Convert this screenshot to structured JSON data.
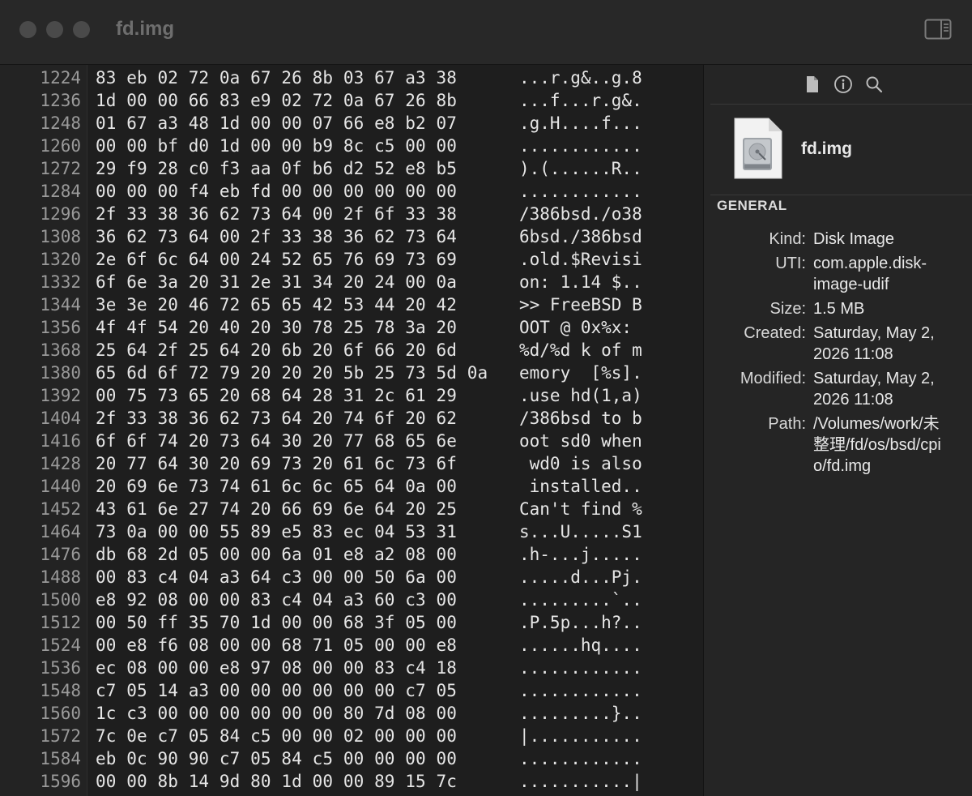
{
  "window": {
    "title": "fd.img"
  },
  "hex": {
    "rows": [
      {
        "offset": "1224",
        "bytes": "83 eb 02 72 0a 67 26 8b 03 67 a3 38",
        "ascii": "...r.g&..g.8"
      },
      {
        "offset": "1236",
        "bytes": "1d 00 00 66 83 e9 02 72 0a 67 26 8b",
        "ascii": "...f...r.g&."
      },
      {
        "offset": "1248",
        "bytes": "01 67 a3 48 1d 00 00 07 66 e8 b2 07",
        "ascii": ".g.H....f..."
      },
      {
        "offset": "1260",
        "bytes": "00 00 bf d0 1d 00 00 b9 8c c5 00 00",
        "ascii": "............"
      },
      {
        "offset": "1272",
        "bytes": "29 f9 28 c0 f3 aa 0f b6 d2 52 e8 b5",
        "ascii": ").(......R.."
      },
      {
        "offset": "1284",
        "bytes": "00 00 00 f4 eb fd 00 00 00 00 00 00",
        "ascii": "............"
      },
      {
        "offset": "1296",
        "bytes": "2f 33 38 36 62 73 64 00 2f 6f 33 38",
        "ascii": "/386bsd./o38"
      },
      {
        "offset": "1308",
        "bytes": "36 62 73 64 00 2f 33 38 36 62 73 64",
        "ascii": "6bsd./386bsd"
      },
      {
        "offset": "1320",
        "bytes": "2e 6f 6c 64 00 24 52 65 76 69 73 69",
        "ascii": ".old.$Revisi"
      },
      {
        "offset": "1332",
        "bytes": "6f 6e 3a 20 31 2e 31 34 20 24 00 0a",
        "ascii": "on: 1.14 $.."
      },
      {
        "offset": "1344",
        "bytes": "3e 3e 20 46 72 65 65 42 53 44 20 42",
        "ascii": ">> FreeBSD B"
      },
      {
        "offset": "1356",
        "bytes": "4f 4f 54 20 40 20 30 78 25 78 3a 20",
        "ascii": "OOT @ 0x%x: "
      },
      {
        "offset": "1368",
        "bytes": "25 64 2f 25 64 20 6b 20 6f 66 20 6d",
        "ascii": "%d/%d k of m"
      },
      {
        "offset": "1380",
        "bytes": "65 6d 6f 72 79 20 20 20 5b 25 73 5d 0a",
        "ascii": "emory  [%s]."
      },
      {
        "offset": "1392",
        "bytes": "00 75 73 65 20 68 64 28 31 2c 61 29",
        "ascii": ".use hd(1,a)"
      },
      {
        "offset": "1404",
        "bytes": "2f 33 38 36 62 73 64 20 74 6f 20 62",
        "ascii": "/386bsd to b"
      },
      {
        "offset": "1416",
        "bytes": "6f 6f 74 20 73 64 30 20 77 68 65 6e",
        "ascii": "oot sd0 when"
      },
      {
        "offset": "1428",
        "bytes": "20 77 64 30 20 69 73 20 61 6c 73 6f",
        "ascii": " wd0 is also"
      },
      {
        "offset": "1440",
        "bytes": "20 69 6e 73 74 61 6c 6c 65 64 0a 00",
        "ascii": " installed.."
      },
      {
        "offset": "1452",
        "bytes": "43 61 6e 27 74 20 66 69 6e 64 20 25",
        "ascii": "Can't find %"
      },
      {
        "offset": "1464",
        "bytes": "73 0a 00 00 55 89 e5 83 ec 04 53 31",
        "ascii": "s...U.....S1"
      },
      {
        "offset": "1476",
        "bytes": "db 68 2d 05 00 00 6a 01 e8 a2 08 00",
        "ascii": ".h-...j....."
      },
      {
        "offset": "1488",
        "bytes": "00 83 c4 04 a3 64 c3 00 00 50 6a 00",
        "ascii": ".....d...Pj."
      },
      {
        "offset": "1500",
        "bytes": "e8 92 08 00 00 83 c4 04 a3 60 c3 00",
        "ascii": ".........`.."
      },
      {
        "offset": "1512",
        "bytes": "00 50 ff 35 70 1d 00 00 68 3f 05 00",
        "ascii": ".P.5p...h?.."
      },
      {
        "offset": "1524",
        "bytes": "00 e8 f6 08 00 00 68 71 05 00 00 e8",
        "ascii": "......hq...."
      },
      {
        "offset": "1536",
        "bytes": "ec 08 00 00 e8 97 08 00 00 83 c4 18",
        "ascii": "............"
      },
      {
        "offset": "1548",
        "bytes": "c7 05 14 a3 00 00 00 00 00 00 c7 05",
        "ascii": "............"
      },
      {
        "offset": "1560",
        "bytes": "1c c3 00 00 00 00 00 00 80 7d 08 00",
        "ascii": ".........}.."
      },
      {
        "offset": "1572",
        "bytes": "7c 0e c7 05 84 c5 00 00 02 00 00 00",
        "ascii": "|..........."
      },
      {
        "offset": "1584",
        "bytes": "eb 0c 90 90 c7 05 84 c5 00 00 00 00",
        "ascii": "............"
      },
      {
        "offset": "1596",
        "bytes": "00 00 8b 14 9d 80 1d 00 00 89 15 7c",
        "ascii": "...........|"
      }
    ]
  },
  "inspector": {
    "tabs": [
      {
        "name": "file-tab",
        "icon": "document-icon"
      },
      {
        "name": "info-tab",
        "icon": "info-icon"
      },
      {
        "name": "search-tab",
        "icon": "magnifier-icon"
      }
    ],
    "file_name": "fd.img",
    "section_title": "GENERAL",
    "fields": [
      {
        "label": "Kind:",
        "value": "Disk Image"
      },
      {
        "label": "UTI:",
        "value": "com.apple.disk-image-udif"
      },
      {
        "label": "Size:",
        "value": "1.5 MB"
      },
      {
        "label": "Created:",
        "value": "Saturday, May 2, 2026 11:08"
      },
      {
        "label": "Modified:",
        "value": "Saturday, May 2, 2026 11:08"
      },
      {
        "label": "Path:",
        "value": "/Volumes/work/未整理/fd/os/bsd/cpio/fd.img"
      }
    ]
  },
  "colors": {
    "background": "#1e1e1e",
    "titlebar": "#282828",
    "inspector": "#252525",
    "text": "#e6e6e6",
    "offset_text": "#9a9a9a"
  }
}
